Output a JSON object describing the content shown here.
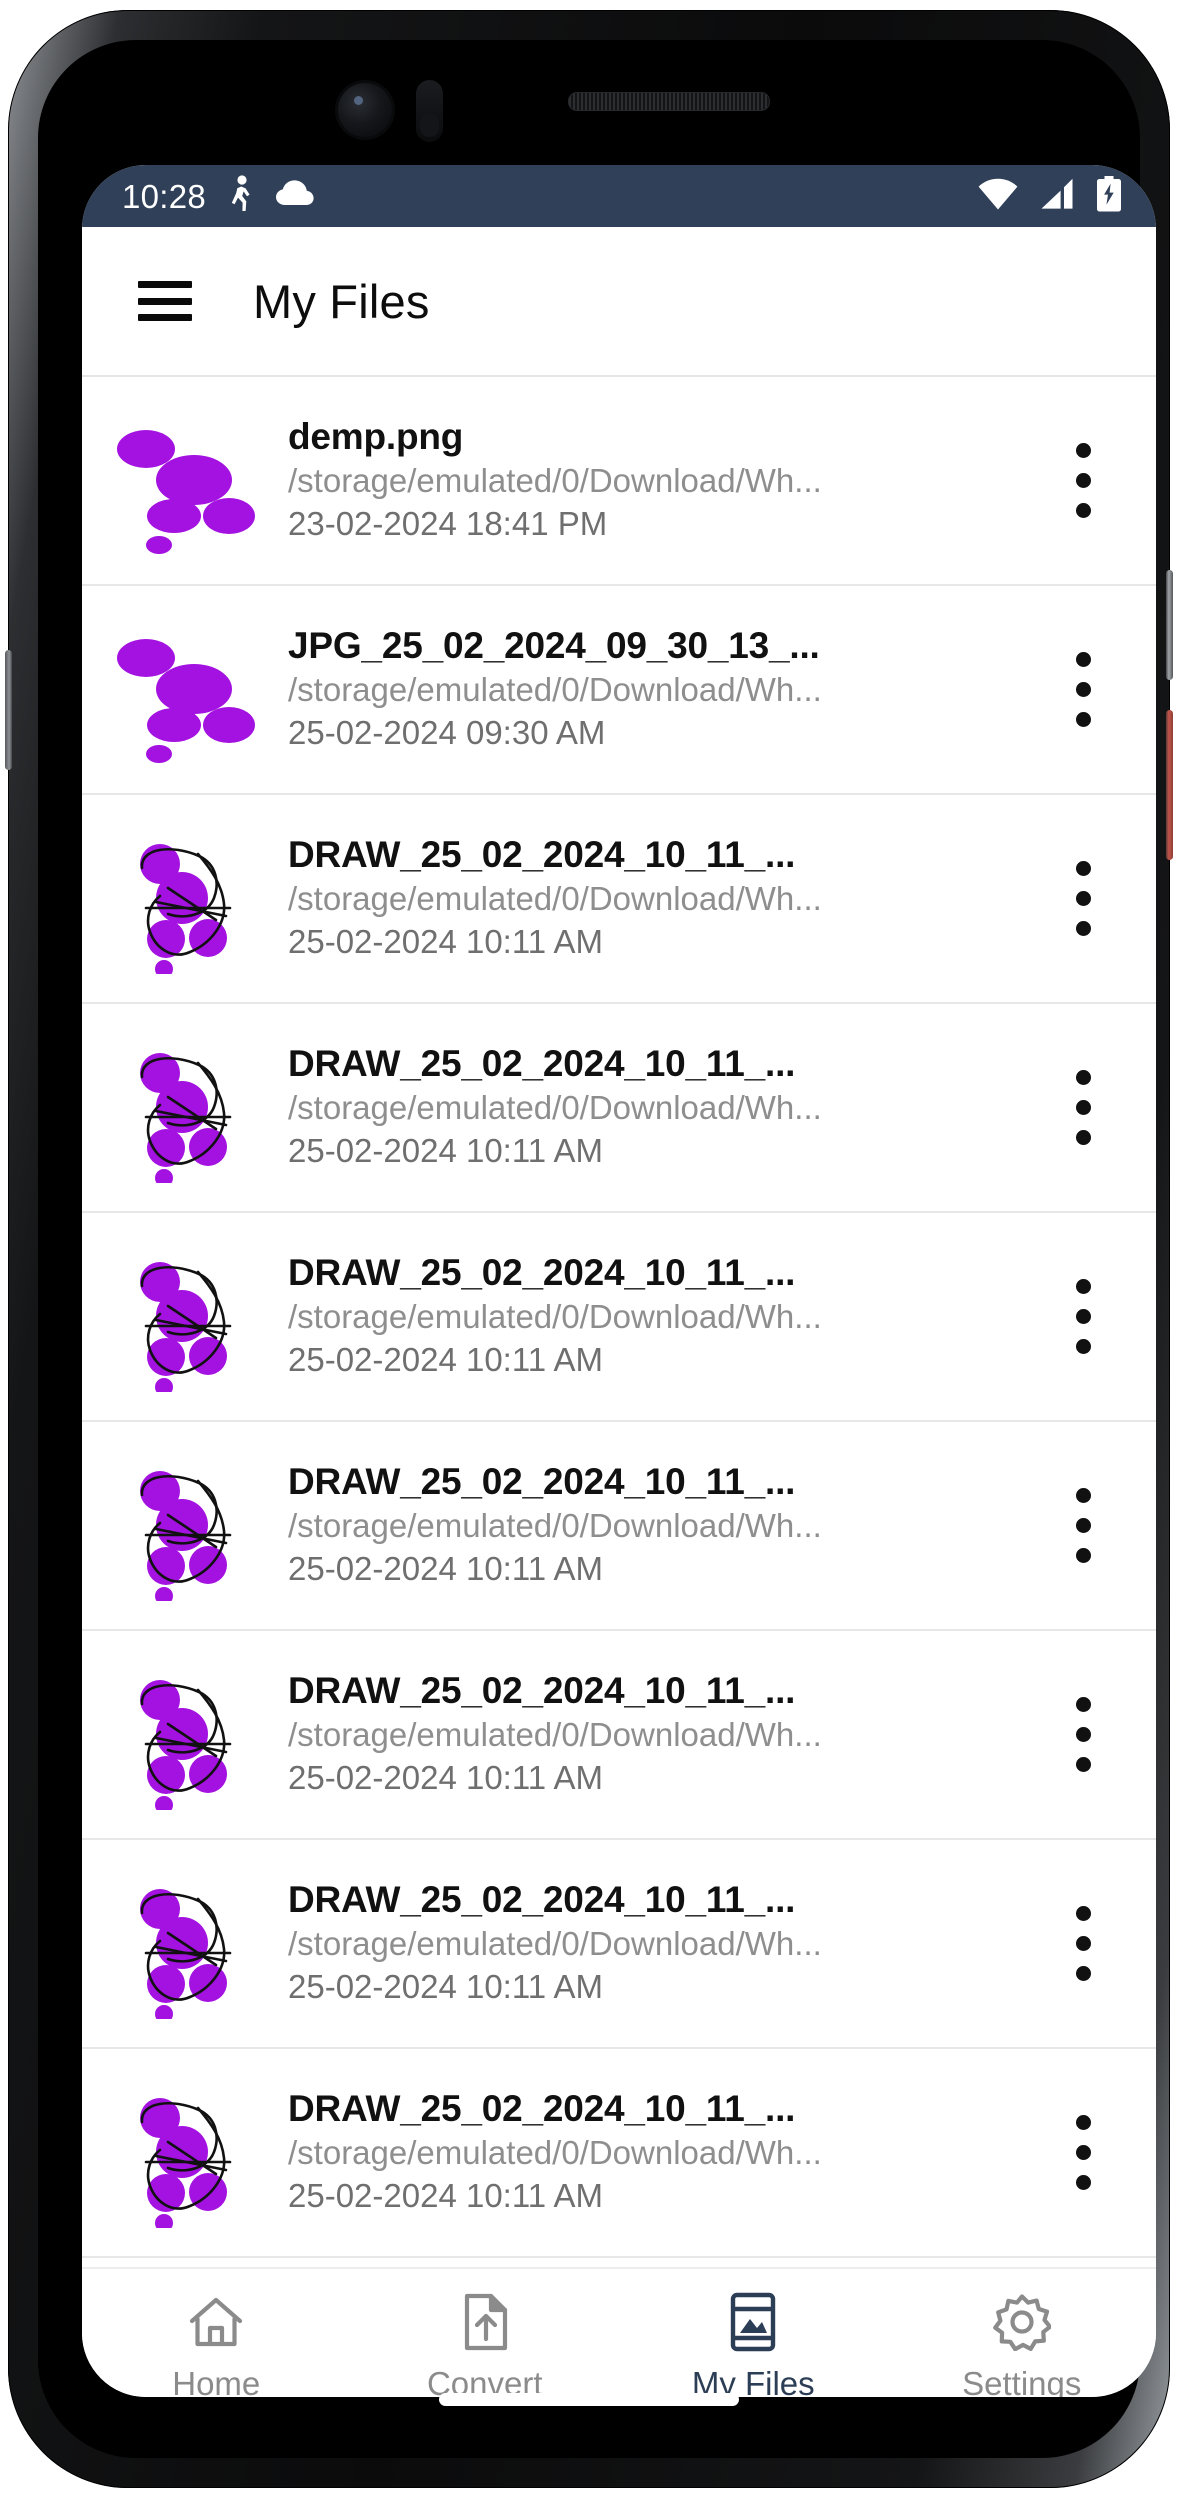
{
  "status_bar": {
    "time": "10:28",
    "left_icons": [
      "walking-icon",
      "cloud-icon"
    ],
    "right_icons": [
      "wifi-icon",
      "cellular-signal-icon",
      "battery-charging-icon"
    ],
    "background_color": "#2f4058",
    "foreground_color": "#ffffff"
  },
  "app_bar": {
    "menu_icon": "hamburger-menu-icon",
    "title": "My Files"
  },
  "theme": {
    "accent": "#2c3e56",
    "thumb_purple": "#a312e0",
    "inactive_nav": "#8b8b8b",
    "path_text": "#8e8e8e",
    "date_text": "#6f6f6f"
  },
  "files": [
    {
      "name": "demp.png",
      "path": "/storage/emulated/0/Download/Wh...",
      "date": "23-02-2024 18:41 PM",
      "thumb": "blob-cluster",
      "overflow_icon": "more-vertical-icon"
    },
    {
      "name": "JPG_25_02_2024_09_30_13_...",
      "path": "/storage/emulated/0/Download/Wh...",
      "date": "25-02-2024 09:30 AM",
      "thumb": "blob-cluster",
      "overflow_icon": "more-vertical-icon"
    },
    {
      "name": "DRAW_25_02_2024_10_11_...",
      "path": "/storage/emulated/0/Download/Wh...",
      "date": "25-02-2024 10:11 AM",
      "thumb": "blob-scribble",
      "overflow_icon": "more-vertical-icon"
    },
    {
      "name": "DRAW_25_02_2024_10_11_...",
      "path": "/storage/emulated/0/Download/Wh...",
      "date": "25-02-2024 10:11 AM",
      "thumb": "blob-scribble",
      "overflow_icon": "more-vertical-icon"
    },
    {
      "name": "DRAW_25_02_2024_10_11_...",
      "path": "/storage/emulated/0/Download/Wh...",
      "date": "25-02-2024 10:11 AM",
      "thumb": "blob-scribble",
      "overflow_icon": "more-vertical-icon"
    },
    {
      "name": "DRAW_25_02_2024_10_11_...",
      "path": "/storage/emulated/0/Download/Wh...",
      "date": "25-02-2024 10:11 AM",
      "thumb": "blob-scribble",
      "overflow_icon": "more-vertical-icon"
    },
    {
      "name": "DRAW_25_02_2024_10_11_...",
      "path": "/storage/emulated/0/Download/Wh...",
      "date": "25-02-2024 10:11 AM",
      "thumb": "blob-scribble",
      "overflow_icon": "more-vertical-icon"
    },
    {
      "name": "DRAW_25_02_2024_10_11_...",
      "path": "/storage/emulated/0/Download/Wh...",
      "date": "25-02-2024 10:11 AM",
      "thumb": "blob-scribble",
      "overflow_icon": "more-vertical-icon"
    },
    {
      "name": "DRAW_25_02_2024_10_11_...",
      "path": "/storage/emulated/0/Download/Wh...",
      "date": "25-02-2024 10:11 AM",
      "thumb": "blob-scribble",
      "overflow_icon": "more-vertical-icon"
    }
  ],
  "bottom_nav": {
    "items": [
      {
        "label": "Home",
        "icon": "home-icon",
        "active": false
      },
      {
        "label": "Convert",
        "icon": "file-upload-icon",
        "active": false
      },
      {
        "label": "My Files",
        "icon": "gallery-icon",
        "active": true
      },
      {
        "label": "Settings",
        "icon": "gear-icon",
        "active": false
      }
    ]
  }
}
